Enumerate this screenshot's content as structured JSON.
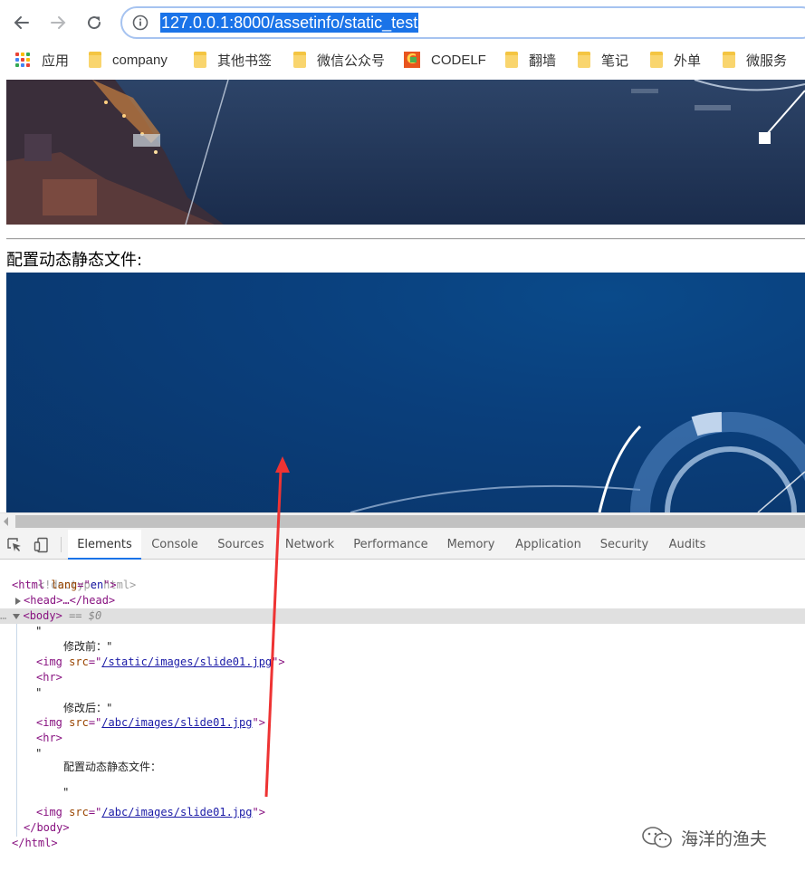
{
  "browser": {
    "url": "127.0.0.1:8000/assetinfo/static_test",
    "bookmarks": [
      {
        "label": "应用",
        "icon": "apps-grid-icon"
      },
      {
        "label": "company",
        "icon": "folder-icon"
      },
      {
        "label": "其他书签",
        "icon": "folder-icon"
      },
      {
        "label": "微信公众号",
        "icon": "folder-icon"
      },
      {
        "label": "CODELF",
        "icon": "codelf-icon"
      },
      {
        "label": "翻墙",
        "icon": "folder-icon"
      },
      {
        "label": "笔记",
        "icon": "folder-icon"
      },
      {
        "label": "外单",
        "icon": "folder-icon"
      },
      {
        "label": "微服务",
        "icon": "folder-icon"
      }
    ]
  },
  "page": {
    "label": "配置动态静态文件:"
  },
  "devtools": {
    "tabs": [
      "Elements",
      "Console",
      "Sources",
      "Network",
      "Performance",
      "Memory",
      "Application",
      "Security",
      "Audits"
    ],
    "active_tab": "Elements",
    "dom": {
      "doctype": "<!doctype html>",
      "html_open_tag": "html",
      "html_attr_name": "lang",
      "html_attr_value": "en",
      "head_collapsed": "<head>…</head>",
      "body_tag": "<body>",
      "selected_marker": "== $0",
      "quote": "\"",
      "text_before": "修改前：\"",
      "img1_src": "/static/images/slide01.jpg",
      "text_after": "修改后：\"",
      "img2_src": "/abc/images/slide01.jpg",
      "text_config": "配置动态静态文件：",
      "img3_src": "/abc/images/slide01.jpg",
      "body_close": "</body>",
      "html_close": "</html>",
      "img_tag": "img",
      "src_attr": "src",
      "hr_tag": "<hr>",
      "ellipsis": "…"
    }
  },
  "colors": {
    "accent": "#1a73e8",
    "annotation_arrow": "#ee3333"
  },
  "watermark": {
    "text": "海洋的渔夫",
    "icon": "wechat-icon"
  }
}
